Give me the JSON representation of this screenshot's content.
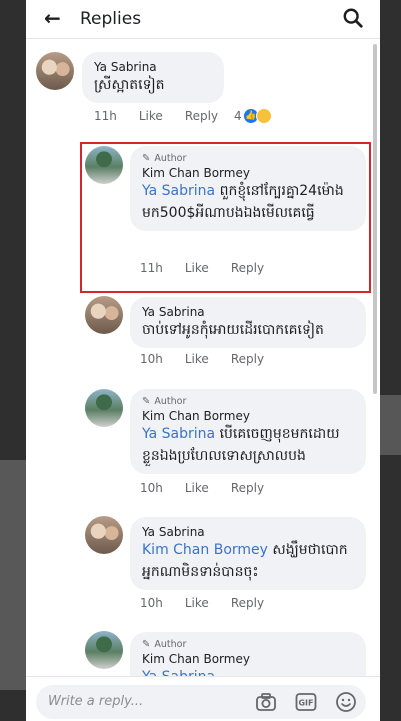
{
  "header": {
    "title": "Replies"
  },
  "comments": [
    {
      "name": "Ya Sabrina",
      "text": "ស្រីស្អាតទៀត",
      "time": "11h",
      "like": "Like",
      "reply": "Reply",
      "reactions": "4"
    },
    {
      "author_tag": "Author",
      "name": "Kim Chan Bormey",
      "mention": "Ya Sabrina",
      "text": "ពួកខ្ញុំនៅក្បែរគ្នា24ម៉ោង  មក500$អីណាបងឯងមើលគេធ្វើ",
      "time": "11h",
      "like": "Like",
      "reply": "Reply"
    },
    {
      "name": "Ya Sabrina",
      "text": "ចាប់ទៅអូនកុំអោយដើរបោកគេទៀត",
      "time": "10h",
      "like": "Like",
      "reply": "Reply"
    },
    {
      "author_tag": "Author",
      "name": "Kim Chan Bormey",
      "mention": "Ya Sabrina",
      "text": "បើគេចេញមុខមកដោយខ្លួនឯងប្រហែលទោសស្រាលបង",
      "time": "10h",
      "like": "Like",
      "reply": "Reply"
    },
    {
      "name": "Ya Sabrina",
      "mention": "Kim Chan Bormey",
      "text": "សង្ឃឹមថាបោកអ្នកណាមិនទាន់បានចុះ",
      "time": "10h",
      "like": "Like",
      "reply": "Reply"
    },
    {
      "author_tag": "Author",
      "name": "Kim Chan Bormey",
      "mention": "Ya Sabrina"
    }
  ],
  "composer": {
    "placeholder": "Write a reply..."
  },
  "icons": [
    "back-arrow-icon",
    "search-icon",
    "camera-icon",
    "gif-icon",
    "emoji-icon",
    "pencil-icon",
    "like-reaction-icon",
    "haha-reaction-icon"
  ]
}
